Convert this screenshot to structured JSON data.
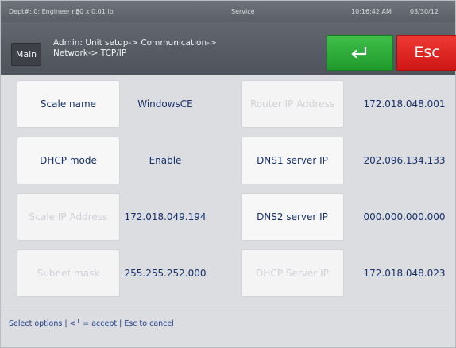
{
  "status_bar": {
    "department": "Dept#: 0: Engineering",
    "capacity": "30 x 0.01 lb",
    "mode": "Service",
    "time": "10:16:42 AM",
    "date": "03/30/12"
  },
  "header": {
    "main_label": "Main",
    "breadcrumb_line1": "Admin: Unit setup-> Communication->",
    "breadcrumb_line2": "Network-> TCP/IP",
    "accept_icon": "enter-return-icon",
    "esc_label": "Esc"
  },
  "fields": {
    "scale_name": {
      "label": "Scale name",
      "value": "WindowsCE"
    },
    "dhcp_mode": {
      "label": "DHCP mode",
      "value": "Enable"
    },
    "scale_ip": {
      "label": "Scale IP Address",
      "value": "172.018.049.194"
    },
    "subnet_mask": {
      "label": "Subnet mask",
      "value": "255.255.252.000"
    },
    "router_ip": {
      "label": "Router IP Address",
      "value": "172.018.048.001"
    },
    "dns1": {
      "label": "DNS1 server IP",
      "value": "202.096.134.133"
    },
    "dns2": {
      "label": "DNS2 server IP",
      "value": "000.000.000.000"
    },
    "dhcp_server": {
      "label": "DHCP Server IP",
      "value": "172.018.048.023"
    }
  },
  "footer": {
    "hint": "Select options | <┘ = accept | Esc to cancel"
  },
  "colors": {
    "accept": "#1f9a2b",
    "escape": "#cf1715",
    "text": "#15306a",
    "disabled_text": "#cfd1d6"
  }
}
